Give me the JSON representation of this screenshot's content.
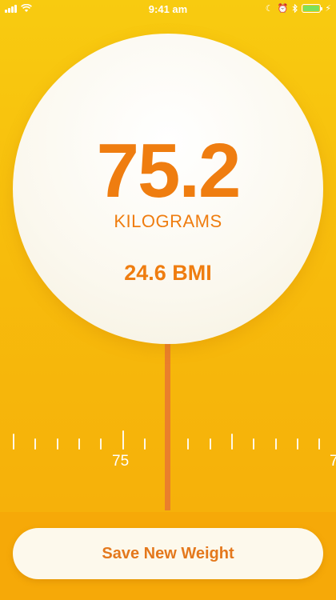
{
  "status": {
    "time": "9:41 am",
    "icons": [
      "signal-icon",
      "wifi-icon",
      "moon-icon",
      "alarm-icon",
      "bluetooth-icon",
      "battery-icon",
      "charging-icon"
    ],
    "battery_color": "#7ee05b"
  },
  "dial": {
    "weight": "75.2",
    "unit": "KILOGRAMS",
    "bmi": "24.6 BMI"
  },
  "ruler": {
    "labels": [
      "75",
      "7"
    ]
  },
  "actions": {
    "save_label": "Save New Weight"
  },
  "colors": {
    "accent": "#ef7d10",
    "background_top": "#f8cb10",
    "background_bottom": "#f5ad09",
    "pointer": "#ea7f2b"
  }
}
